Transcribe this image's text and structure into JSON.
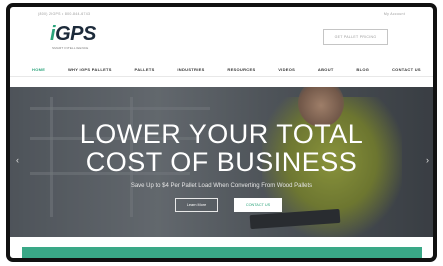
{
  "topbar": {
    "phone": "(800) 2IGPS • 800-844-6743",
    "account": "My Account"
  },
  "header": {
    "logo_text": "GPS",
    "logo_prefix": "i",
    "logo_tagline": "SMART INTELLIGENCE",
    "cta_label": "GET PALLET PRICING"
  },
  "nav": {
    "items": [
      {
        "label": "HOME",
        "active": true
      },
      {
        "label": "WHY iGPS PALLETS"
      },
      {
        "label": "PALLETS"
      },
      {
        "label": "INDUSTRIES"
      },
      {
        "label": "RESOURCES"
      },
      {
        "label": "VIDEOS"
      },
      {
        "label": "ABOUT"
      },
      {
        "label": "BLOG"
      },
      {
        "label": "CONTACT US"
      }
    ]
  },
  "hero": {
    "title_line1": "LOWER YOUR TOTAL",
    "title_line2": "COST OF BUSINESS",
    "subtitle": "Save Up to $4 Per Pallet Load When Converting From Wood Pallets",
    "learn_label": "Learn More",
    "contact_label": "CONTACT US",
    "prev_icon": "chevron-left-icon",
    "next_icon": "chevron-right-icon"
  },
  "colors": {
    "accent": "#2aa37a",
    "band": "#3aa887",
    "frame": "#111111"
  }
}
